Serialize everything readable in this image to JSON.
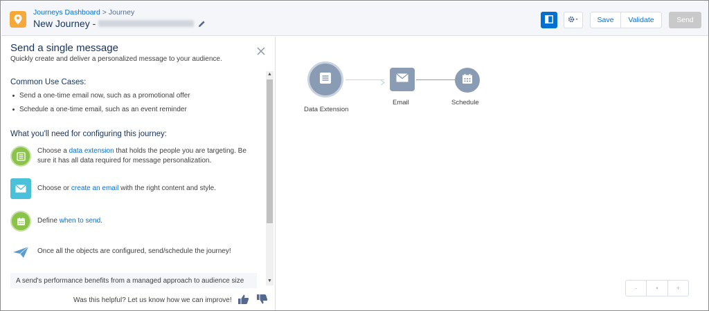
{
  "header": {
    "breadcrumb_link": "Journeys Dashboard",
    "breadcrumb_separator": " > ",
    "breadcrumb_current": "Journey",
    "journey_title": "New Journey -",
    "buttons": {
      "save": "Save",
      "validate": "Validate",
      "send": "Send"
    }
  },
  "panel": {
    "title": "Send a single message",
    "subtitle": "Quickly create and deliver a personalized message to your audience.",
    "use_cases_heading": "Common Use Cases:",
    "use_cases": [
      "Send a one-time email now, such as a promotional offer",
      "Schedule a one-time email, such as an event reminder"
    ],
    "config_heading": "What you'll need for configuring this journey:",
    "steps": [
      {
        "pre": "Choose a ",
        "link": "data extension",
        "post": " that holds the people you are targeting. Be sure it has all data required for message personalization."
      },
      {
        "pre": "Choose or ",
        "link": "create an email",
        "post": " with the right content and style."
      },
      {
        "pre": "Define ",
        "link": "when to send",
        "post": "."
      },
      {
        "text": "Once all the objects are configured, send/schedule the journey!"
      }
    ],
    "note": "A send's performance benefits from a managed approach to audience size",
    "feedback": "Was this helpful? Let us know how we can improve!"
  },
  "canvas": {
    "nodes": [
      {
        "label": "Data Extension"
      },
      {
        "label": "Email"
      },
      {
        "label": "Schedule"
      }
    ],
    "zoom": {
      "out": "-",
      "fit": "•",
      "in": "+"
    }
  },
  "colors": {
    "brand_blue": "#0070d2",
    "app_icon_orange": "#f6a93b",
    "step_green": "#8bc34a",
    "step_teal": "#4bc0d9",
    "node_gray": "#8a9bb4"
  }
}
